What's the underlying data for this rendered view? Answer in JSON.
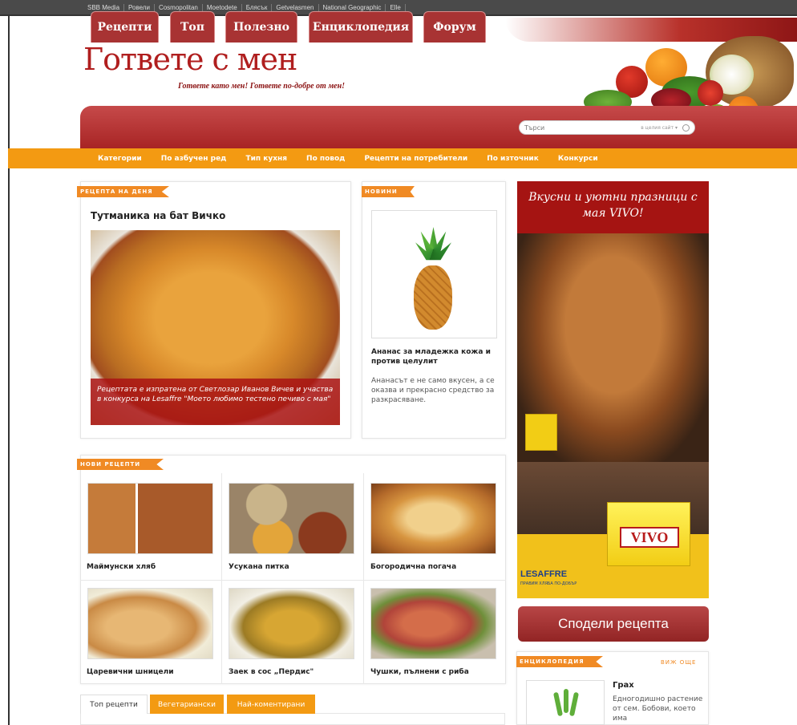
{
  "topbar": {
    "links": [
      "SBB Media",
      "Ровели",
      "Cosmopolitan",
      "Moetodete",
      "Блясък",
      "Getvelasmen",
      "National Geographic",
      "Elle"
    ]
  },
  "header": {
    "logo": "Гответе с мен",
    "tagline": "Гответе като мен! Гответе по-добре от мен!"
  },
  "nav": {
    "tabs": [
      "Рецепти",
      "Топ",
      "Полезно",
      "Енциклопедия",
      "Форум"
    ]
  },
  "search": {
    "placeholder": "Търси",
    "scope": "в целия сайт ▾"
  },
  "subnav": {
    "items": [
      "Категории",
      "По азбучен ред",
      "Тип кухня",
      "По повод",
      "Рецепти на потребители",
      "По източник",
      "Конкурси"
    ]
  },
  "recipe_of_day": {
    "ribbon": "РЕЦЕПТА НА ДЕНЯ",
    "title": "Тутманика на бат Вичко",
    "caption": "Рецептата е изпратена от Светлозар Иванов Вичев и участва в конкурса на Lesaffre \"Моето любимо тестено печиво с мая\""
  },
  "news": {
    "ribbon": "НОВИНИ",
    "title": "Ананас за младежка кожа и против целулит",
    "text": "Ананасът е не само вкусен, а се оказва и прекрасно средство за разкрасяване."
  },
  "ad": {
    "headline": "Вкусни и уютни празници с мая VIVO!",
    "brand": "LESAFFRE",
    "brand_sub": "ПРАВИМ ХЛЯБА ПО-ДОБЪР",
    "product": "VIVO"
  },
  "share_button": "Сподели рецепта",
  "new_recipes": {
    "ribbon": "НОВИ РЕЦЕПТИ",
    "items": [
      "Маймунски хляб",
      "Усукана питка",
      "Богородична погача",
      "Царевични шницели",
      "Заек в сос „Пердис\"",
      "Чушки, пълнени с риба"
    ]
  },
  "bottom_tabs": [
    "Топ рецепти",
    "Вегетариански",
    "Най-коментирани"
  ],
  "encyclopedia": {
    "ribbon": "ЕНЦИКЛОПЕДИЯ",
    "more": "ВИЖ ОЩЕ",
    "title": "Грах",
    "text": "Едногодишно растение от сем. Бобови, което има"
  }
}
